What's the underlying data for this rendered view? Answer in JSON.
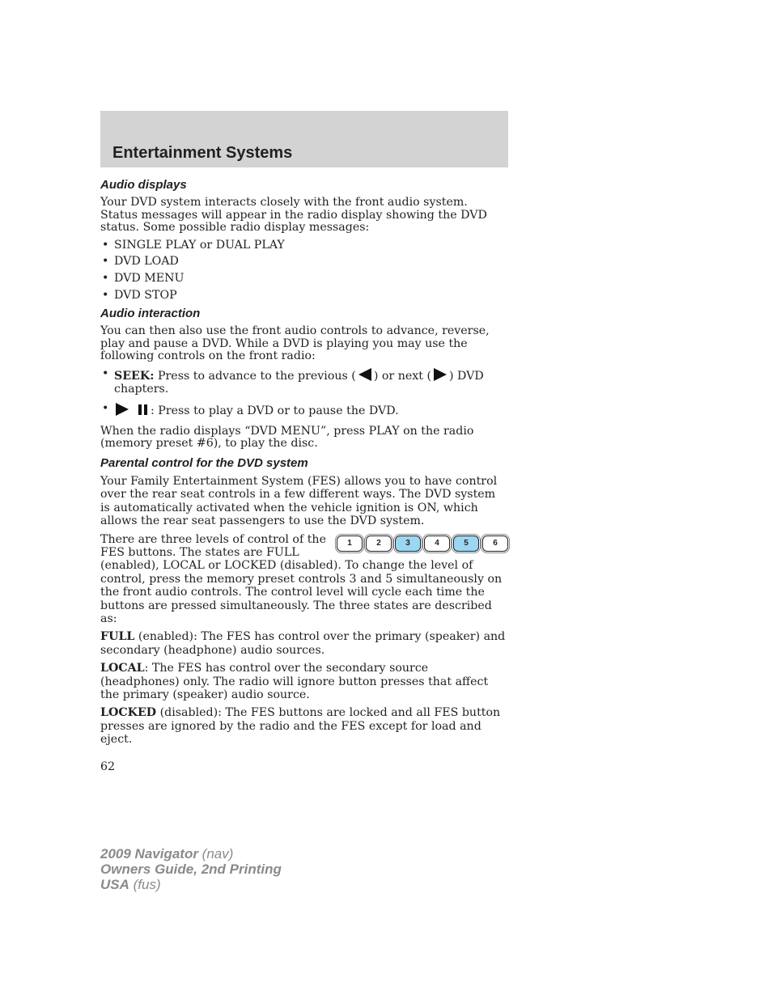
{
  "header": {
    "title": "Entertainment Systems"
  },
  "sections": {
    "audio_displays": {
      "heading": "Audio displays",
      "intro": "Your DVD system interacts closely with the front audio system. Status messages will appear in the radio display showing the DVD status. Some possible radio display messages:",
      "bullets": [
        "SINGLE PLAY or DUAL PLAY",
        "DVD LOAD",
        "DVD MENU",
        "DVD STOP"
      ]
    },
    "audio_interaction": {
      "heading": "Audio interaction",
      "intro": "You can then also use the front audio controls to advance, reverse, play and pause a DVD. While a DVD is playing you may use the following controls on the front radio:",
      "seek_label": "SEEK:",
      "seek_text_1": "Press to advance to the previous (",
      "seek_text_2": ") or next (",
      "seek_text_3": ") DVD chapters.",
      "play_pause_text": ": Press to play a DVD or to pause the DVD.",
      "menu_note": "When the radio displays “DVD MENU”, press PLAY on the radio (memory preset #6), to play the disc."
    },
    "parental_control": {
      "heading": "Parental control for the DVD system",
      "intro": "Your Family Entertainment System (FES) allows you to have control over the rear seat controls in a few different ways. The DVD system is automatically activated when the vehicle ignition is ON, which allows the rear seat passengers to use the DVD system.",
      "levels_text": "There are three levels of control of the FES buttons. The states are FULL (enabled), LOCAL or LOCKED (disabled). To change the level of control, press the memory preset controls 3 and 5 simultaneously on the front audio controls. The control level will cycle each time the buttons are pressed simultaneously. The three states are described as:",
      "preset_buttons": [
        {
          "label": "1",
          "highlighted": false
        },
        {
          "label": "2",
          "highlighted": false
        },
        {
          "label": "3",
          "highlighted": true
        },
        {
          "label": "4",
          "highlighted": false
        },
        {
          "label": "5",
          "highlighted": true
        },
        {
          "label": "6",
          "highlighted": false
        }
      ],
      "highlight_color": "#9bd6f2",
      "full_label": "FULL",
      "full_text": " (enabled): The FES has control over the primary (speaker) and secondary (headphone) audio sources.",
      "local_label": "LOCAL",
      "local_text": ": The FES has control over the secondary source (headphones) only. The radio will ignore button presses that affect the primary (speaker) audio source.",
      "locked_label": "LOCKED",
      "locked_text": " (disabled): The FES buttons are locked and all FES button presses are ignored by the radio and the FES except for load and eject."
    }
  },
  "page_number": "62",
  "footer": {
    "line1_bold": "2009 Navigator",
    "line1_light": " (nav)",
    "line2_bold": "Owners Guide, 2nd Printing",
    "line3_bold": "USA",
    "line3_light": " (fus)"
  }
}
